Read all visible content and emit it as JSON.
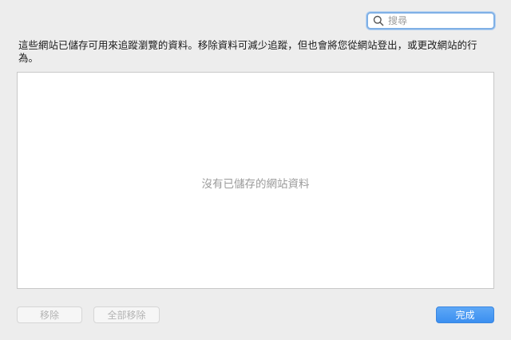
{
  "search": {
    "placeholder": "搜尋",
    "value": "",
    "icon": "magnifying-glass"
  },
  "description": "這些網站已儲存可用來追蹤瀏覽的資料。移除資料可減少追蹤，但也會將您從網站登出，或更改網站的行為。",
  "site_list": {
    "items": [],
    "empty_message": "沒有已儲存的網站資料"
  },
  "buttons": {
    "remove": "移除",
    "remove_all": "全部移除",
    "done": "完成"
  },
  "colors": {
    "accent": "#3b8ff0",
    "focus_ring": "#7fb0e6",
    "background": "#ededed",
    "disabled_text": "#b3b3b3"
  }
}
